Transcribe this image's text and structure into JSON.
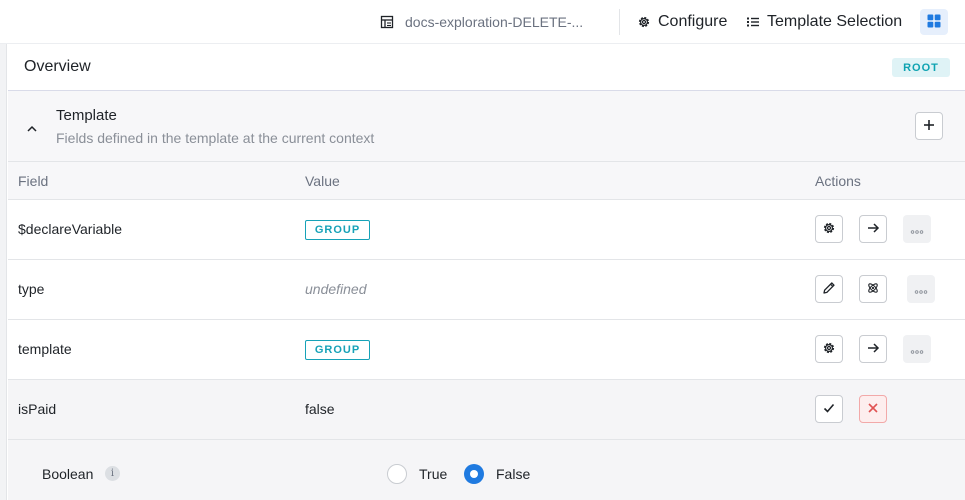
{
  "topbar": {
    "doc_name": "docs-exploration-DELETE-...",
    "configure_label": "Configure",
    "template_selection_label": "Template Selection"
  },
  "overview": {
    "title": "Overview",
    "badge": "ROOT"
  },
  "template_section": {
    "title": "Template",
    "subtitle": "Fields defined in the template at the current context"
  },
  "table": {
    "headers": {
      "field": "Field",
      "value": "Value",
      "actions": "Actions"
    },
    "rows": [
      {
        "field": "$declareVariable",
        "value": "GROUP",
        "value_kind": "badge"
      },
      {
        "field": "type",
        "value": "undefined",
        "value_kind": "undefined"
      },
      {
        "field": "template",
        "value": "GROUP",
        "value_kind": "badge"
      },
      {
        "field": "isPaid",
        "value": "false",
        "value_kind": "text",
        "editing": true
      }
    ]
  },
  "editor": {
    "label": "Boolean",
    "info_glyph": "i",
    "options": [
      {
        "label": "True",
        "selected": false
      },
      {
        "label": "False",
        "selected": true
      }
    ]
  },
  "colors": {
    "accent": "#1f7ae0",
    "group_badge": "#17a2b8",
    "danger": "#e05252"
  }
}
